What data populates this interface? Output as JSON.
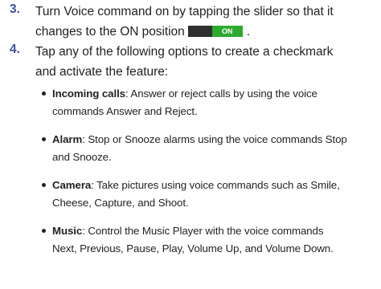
{
  "steps": [
    {
      "number": "3.",
      "line1": "Turn Voice command on by tapping the slider so that it",
      "line2_before": "changes to the ON position",
      "line2_after": ".",
      "slider_label": "ON"
    },
    {
      "number": "4.",
      "line1": "Tap any of the following options to create a checkmark",
      "line2": "and activate the feature:"
    }
  ],
  "options": [
    {
      "name": "Incoming calls",
      "line1": ": Answer or reject calls by using the voice",
      "line2": "commands Answer and Reject."
    },
    {
      "name": "Alarm",
      "line1": ": Stop or Snooze alarms using the voice commands Stop",
      "line2": "and Snooze."
    },
    {
      "name": "Camera",
      "line1": ": Take pictures using voice commands such as Smile,",
      "line2": "Cheese, Capture, and Shoot."
    },
    {
      "name": "Music",
      "line1": ": Control the Music Player with the voice commands",
      "line2": "Next, Previous, Pause, Play, Volume Up, and Volume Down."
    }
  ],
  "colors": {
    "step_number": "#3f4fa0",
    "slider_on": "#2eaa2e",
    "slider_track": "#2f2f2f",
    "text": "#231f20"
  }
}
